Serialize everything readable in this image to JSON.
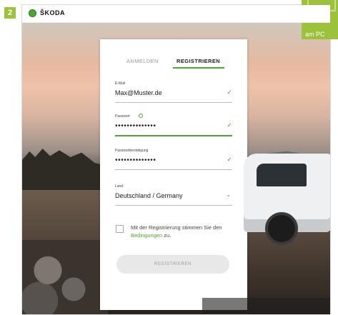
{
  "step_number": "2",
  "brand": {
    "name": "ŠKODA"
  },
  "corner_tab": {
    "label": "am PC"
  },
  "tabs": [
    {
      "label": "ANMELDEN",
      "active": false
    },
    {
      "label": "REGISTRIEREN",
      "active": true
    }
  ],
  "form": {
    "email": {
      "label": "E-Mail",
      "value": "Max@Muster.de",
      "status_icon": "check-icon"
    },
    "password": {
      "label": "Passwort",
      "value": "••••••••••••••",
      "status_icon": "check-icon"
    },
    "password_confirm": {
      "label": "Passwortbestätigung",
      "value": "••••••••••••••",
      "status_icon": "check-icon"
    },
    "country": {
      "label": "Land",
      "value": "Deutschland / Germany",
      "status_icon": "chevron-down-icon"
    },
    "consent": {
      "prefix": "Mit der Registrierung stimmen Sie den ",
      "link": "Bedingungen",
      "suffix": " zu."
    },
    "submit_label": "REGISTRIEREN"
  },
  "colors": {
    "accent": "#4ba82e",
    "badge": "#9cc13a"
  }
}
